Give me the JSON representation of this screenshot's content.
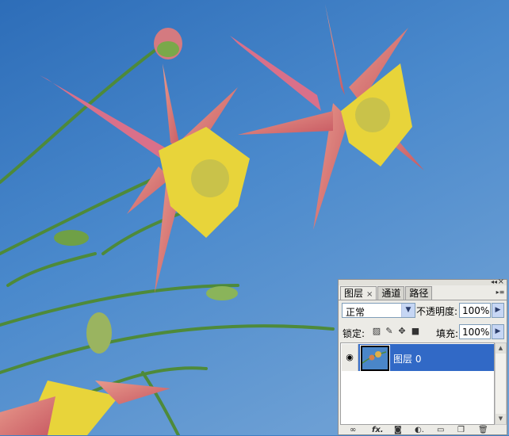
{
  "panel": {
    "tabs": [
      {
        "label": "图层",
        "close": "×"
      },
      {
        "label": "通道"
      },
      {
        "label": "路径"
      }
    ],
    "blend_mode": "正常",
    "opacity_label": "不透明度:",
    "opacity_value": "100%",
    "lock_label": "锁定:",
    "fill_label": "填充:",
    "fill_value": "100%",
    "layers": [
      {
        "name": "图层 0",
        "visible": true,
        "selected": true
      }
    ],
    "icons": {
      "blend_dropdown": "chevron-down-icon",
      "opacity_slider": "triangle-right-icon",
      "lock": [
        "lock-transparency-icon",
        "lock-brush-icon",
        "lock-move-icon",
        "lock-all-icon"
      ],
      "toolbar": [
        "link-icon",
        "fx-icon",
        "mask-icon",
        "adjustment-icon",
        "folder-icon",
        "new-layer-icon",
        "trash-icon"
      ]
    },
    "colors": {
      "selection": "#3169c6",
      "panel_bg": "#ecebe6"
    }
  },
  "canvas": {
    "subject": "red-yellow columbine flowers against blue sky",
    "colors": {
      "sky": "#3f7ec4",
      "petal": "#d87a78",
      "yellow": "#e8d43a",
      "stem": "#4f8a3a"
    }
  }
}
